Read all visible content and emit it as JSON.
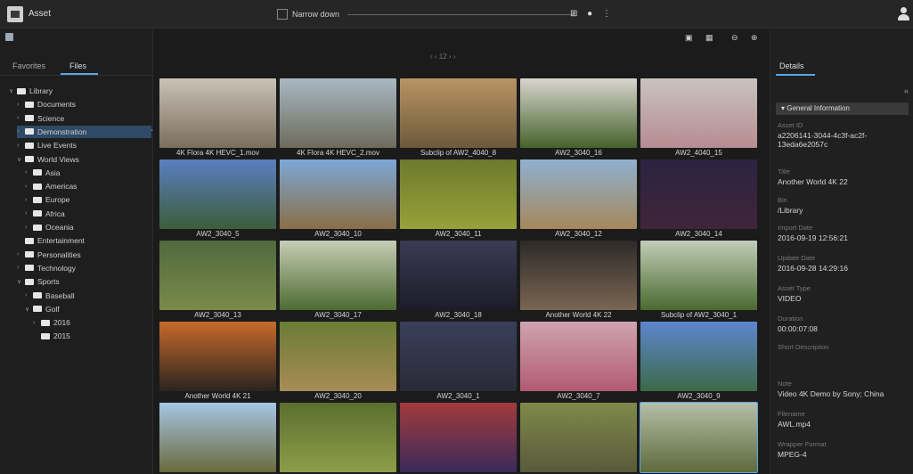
{
  "app": {
    "title": "Asset"
  },
  "topbar": {
    "narrow_label": "Narrow down",
    "icons": "⊞ ● ⋮"
  },
  "left": {
    "tabs": [
      "Favorites",
      "Files"
    ],
    "tree": [
      {
        "label": "Library",
        "caret": "∨"
      },
      {
        "label": "Documents",
        "caret": "›"
      },
      {
        "label": "Science",
        "caret": "›"
      },
      {
        "label": "Demonstration",
        "caret": "›"
      },
      {
        "label": "Live Events",
        "caret": "›"
      },
      {
        "label": "World Views",
        "caret": "∨"
      },
      {
        "label": "Asia",
        "caret": "›"
      },
      {
        "label": "Americas",
        "caret": "›"
      },
      {
        "label": "Europe",
        "caret": "›"
      },
      {
        "label": "Africa",
        "caret": "›"
      },
      {
        "label": "Oceania",
        "caret": "›"
      },
      {
        "label": "Entertainment",
        "caret": ""
      },
      {
        "label": "Personalities",
        "caret": "›"
      },
      {
        "label": "Technology",
        "caret": "›"
      },
      {
        "label": "Sports",
        "caret": "∨"
      },
      {
        "label": "Baseball",
        "caret": "›"
      },
      {
        "label": "Golf",
        "caret": "∨"
      },
      {
        "label": "2016",
        "caret": "›"
      },
      {
        "label": "2015",
        "caret": ""
      }
    ],
    "more": "⋯"
  },
  "grid": {
    "view_icons": "▣ ▦",
    "zoom_icons": "⊖ ⊕",
    "pager": "‹ ‹  12  › ›",
    "items": [
      {
        "label": "4K Flora 4K HEVC_1.mov",
        "c1": "#c9c2b6",
        "c2": "#7a6f5e"
      },
      {
        "label": "4K Flora 4K HEVC_2.mov",
        "c1": "#a9b9c4",
        "c2": "#6e6b5a"
      },
      {
        "label": "Subclip of AW2_4040_8",
        "c1": "#b99464",
        "c2": "#6c5a3b"
      },
      {
        "label": "AW2_3040_16",
        "c1": "#d8d5ce",
        "c2": "#46632b"
      },
      {
        "label": "AW2_4040_15",
        "c1": "#c8c3be",
        "c2": "#b78c92"
      },
      {
        "label": "AW2_3040_5",
        "c1": "#5a7fc1",
        "c2": "#3d5d3a"
      },
      {
        "label": "AW2_3040_10",
        "c1": "#7ca8d8",
        "c2": "#8a6e47"
      },
      {
        "label": "AW2_3040_11",
        "c1": "#6d7a2c",
        "c2": "#97a23a"
      },
      {
        "label": "AW2_3040_12",
        "c1": "#8fb0cf",
        "c2": "#a5885b"
      },
      {
        "label": "AW2_3040_14",
        "c1": "#2a2440",
        "c2": "#40253a"
      },
      {
        "label": "AW2_3040_13",
        "c1": "#4f6a3e",
        "c2": "#7b8a4a"
      },
      {
        "label": "AW2_3040_17",
        "c1": "#c7cdb6",
        "c2": "#4d6b31"
      },
      {
        "label": "AW2_3040_18",
        "c1": "#3b3b56",
        "c2": "#1c1c28"
      },
      {
        "label": "Another World 4K 22",
        "c1": "#2c2a2a",
        "c2": "#7a6651"
      },
      {
        "label": "Subclip of AW2_3040_1",
        "c1": "#c2cdb8",
        "c2": "#4a6a2f"
      },
      {
        "label": "Another World 4K 21",
        "c1": "#c86a2a",
        "c2": "#2a2420"
      },
      {
        "label": "AW2_3040_20",
        "c1": "#6b7c35",
        "c2": "#a78c56"
      },
      {
        "label": "AW2_3040_1",
        "c1": "#3a3f5a",
        "c2": "#2a2b38"
      },
      {
        "label": "AW2_3040_7",
        "c1": "#cfa3b1",
        "c2": "#b25b73"
      },
      {
        "label": "AW2_3040_9",
        "c1": "#5d86cf",
        "c2": "#3c6a48"
      },
      {
        "label": "",
        "c1": "#a6c6e6",
        "c2": "#6a6a3b"
      },
      {
        "label": "",
        "c1": "#5b6f2e",
        "c2": "#8e9d4a"
      },
      {
        "label": "",
        "c1": "#a23b3c",
        "c2": "#3a2a5a"
      },
      {
        "label": "",
        "c1": "#7e8a4a",
        "c2": "#5a5a3a"
      },
      {
        "label": "",
        "c1": "#b5bfa8",
        "c2": "#5e6a3c"
      }
    ]
  },
  "right": {
    "details_tab": "Details",
    "section": "General Information",
    "collapse_icon": "«",
    "fields": [
      {
        "key": "Asset ID",
        "value": "a2206141-3044-4c3f-ac2f-13eda6e2057c"
      },
      {
        "key": "Title",
        "value": "Another World 4K 22"
      },
      {
        "key": "Bin",
        "value": "/Library"
      },
      {
        "key": "Import Date",
        "value": "2016-09-19 12:56:21"
      },
      {
        "key": "Update Date",
        "value": "2016-09-28 14:29:16"
      },
      {
        "key": "Asset Type",
        "value": "VIDEO"
      },
      {
        "key": "Duration",
        "value": "00:00:07:08"
      },
      {
        "key": "Short Description",
        "value": ""
      },
      {
        "key": "Note",
        "value": "Video 4K Demo by Sony; China"
      },
      {
        "key": "Filename",
        "value": "AWL.mp4"
      },
      {
        "key": "Wrapper Format",
        "value": "MPEG-4"
      }
    ]
  }
}
